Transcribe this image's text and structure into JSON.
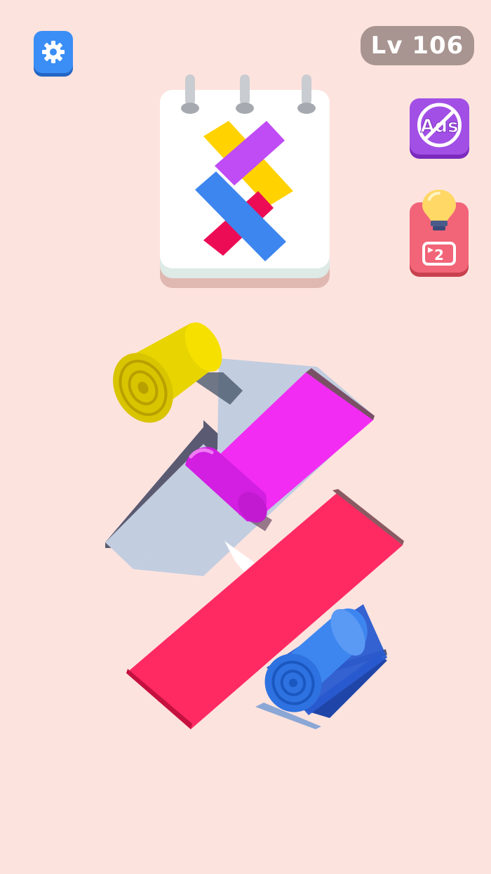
{
  "hud": {
    "level_text": "Lv 106",
    "noads_text": "Ads",
    "hint_count": "2"
  },
  "icons": {
    "settings": "gear-icon",
    "noads": "no-ads-icon",
    "hint": "lightbulb-icon",
    "video": "video-play-icon"
  },
  "colors": {
    "background": "#fde3de",
    "settings_button": "#3a8ef5",
    "level_pill": "#a89490",
    "noads_button": "#a24fe6",
    "hint_button": "#f26478",
    "yellow": "#ffd200",
    "purple": "#c04cf5",
    "magenta": "#f22cf2",
    "blue": "#3e86ef",
    "red": "#ec0c55",
    "pink": "#ff2a62",
    "tile": "#c2cde0"
  },
  "target_pattern": {
    "strips": [
      "yellow",
      "red",
      "purple",
      "blue"
    ]
  },
  "board": {
    "rolls": [
      "yellow",
      "magenta",
      "blue"
    ],
    "unrolled_strips": [
      "magenta",
      "pink"
    ]
  }
}
